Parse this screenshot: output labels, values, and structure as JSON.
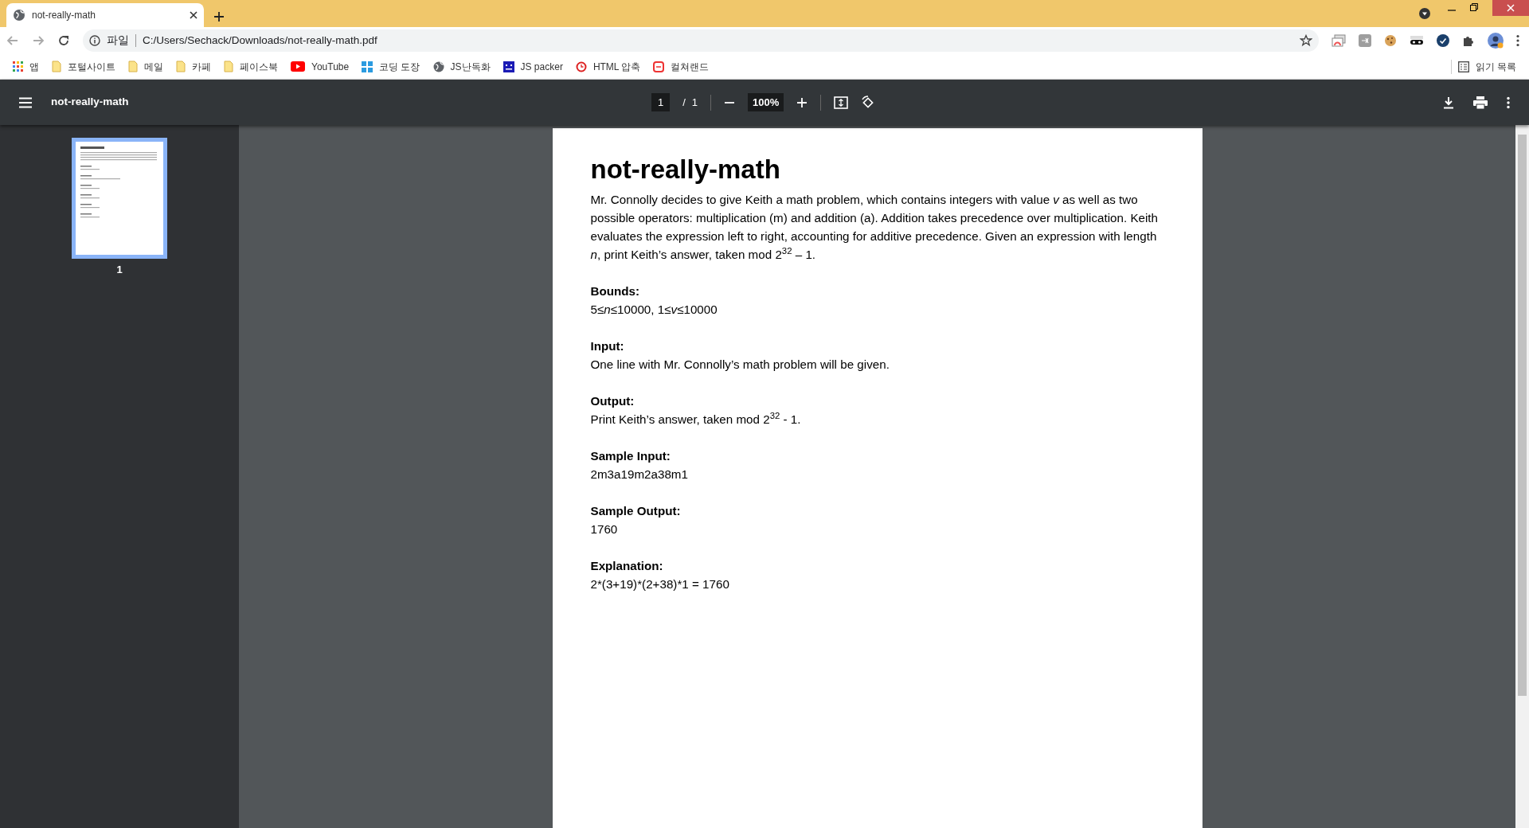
{
  "browser": {
    "tab": {
      "title": "not-really-math",
      "selected": true
    },
    "address": {
      "scheme_label": "파일",
      "url": "C:/Users/Sechack/Downloads/not-really-math.pdf"
    },
    "bookmarks": [
      {
        "label": "앱",
        "kind": "apps"
      },
      {
        "label": "포털사이트",
        "kind": "folder"
      },
      {
        "label": "메일",
        "kind": "folder"
      },
      {
        "label": "카페",
        "kind": "folder"
      },
      {
        "label": "페이스북",
        "kind": "folder"
      },
      {
        "label": "YouTube",
        "kind": "video"
      },
      {
        "label": "코딩 도장",
        "kind": "blocks"
      },
      {
        "label": "JS난독화",
        "kind": "globe"
      },
      {
        "label": "JS packer",
        "kind": "square"
      },
      {
        "label": "HTML 압축",
        "kind": "ring"
      },
      {
        "label": "컬쳐랜드",
        "kind": "badge"
      }
    ],
    "reading_list": "읽기 목록"
  },
  "viewer": {
    "title": "not-really-math",
    "page_current": "1",
    "page_separator": "/",
    "page_total": "1",
    "zoom": "100%",
    "thumbnails": [
      {
        "label": "1",
        "selected": true
      }
    ]
  },
  "document": {
    "title": "not-really-math",
    "intro": "Mr. Connolly decides to give Keith a math problem, which contains integers with value *v* as well as two possible operators: multiplication (m) and addition (a). Addition takes precedence over multiplication. Keith evaluates the expression left to right, accounting for additive precedence. Given an expression with length *n*, print Keith’s answer, taken mod 2$^{32}$ – 1.",
    "sections": [
      {
        "heading": "Bounds:",
        "body": "5≤*n*≤10000, 1≤*v*≤10000"
      },
      {
        "heading": "Input:",
        "body": "One line with Mr. Connolly’s math problem will be given."
      },
      {
        "heading": "Output:",
        "body": "Print Keith’s answer, taken mod 2$^{32}$ - 1."
      },
      {
        "heading": "Sample Input:",
        "body": "2m3a19m2a38m1"
      },
      {
        "heading": "Sample Output:",
        "body": "1760"
      },
      {
        "heading": "Explanation:",
        "body": "2*(3+19)*(2+38)*1 = 1760"
      }
    ]
  }
}
